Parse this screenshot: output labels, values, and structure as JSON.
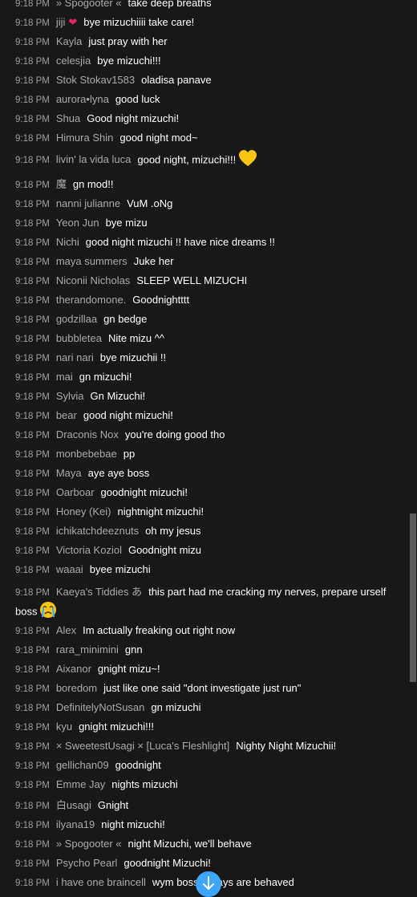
{
  "chat": {
    "messages": [
      {
        "time": "9:18 PM",
        "author": "» Spogooter «",
        "text": "take deep breaths"
      },
      {
        "time": "9:18 PM",
        "author": "jiji",
        "badge": "heart-icon",
        "text": "bye mizuchiiii take care!"
      },
      {
        "time": "9:18 PM",
        "author": "Kayla",
        "text": "just pray with her"
      },
      {
        "time": "9:18 PM",
        "author": "celesjia",
        "text": "bye mizuchi!!!"
      },
      {
        "time": "9:18 PM",
        "author": "Stok Stokav1583",
        "text": "oladisa panave"
      },
      {
        "time": "9:18 PM",
        "author": "aurora•lyna",
        "text": "good luck"
      },
      {
        "time": "9:18 PM",
        "author": "Shua",
        "text": "Good night mizuchi!"
      },
      {
        "time": "9:18 PM",
        "author": "Himura Shin",
        "text": "good night mod~"
      },
      {
        "time": "9:18 PM",
        "author": "livin' la vida luca",
        "text": "good night, mizuchi!!!",
        "emoji": "yellow-heart-emoji"
      },
      {
        "time": "9:18 PM",
        "author": "魔",
        "text": "gn mod!!"
      },
      {
        "time": "9:18 PM",
        "author": "nanni julianne",
        "text": "VuM .oNg"
      },
      {
        "time": "9:18 PM",
        "author": "Yeon Jun",
        "text": "bye mizu"
      },
      {
        "time": "9:18 PM",
        "author": "Nichi",
        "text": "good night mizuchi !! have nice dreams !!"
      },
      {
        "time": "9:18 PM",
        "author": "maya summers",
        "text": "Juke her"
      },
      {
        "time": "9:18 PM",
        "author": "Niconii Nicholas",
        "text": "SLEEP WELL MIZUCHI"
      },
      {
        "time": "9:18 PM",
        "author": "therandomone.",
        "text": "Goodnightttt"
      },
      {
        "time": "9:18 PM",
        "author": "godzillaa",
        "text": "gn bedge"
      },
      {
        "time": "9:18 PM",
        "author": "bubbletea",
        "text": "Nite mizu ^^"
      },
      {
        "time": "9:18 PM",
        "author": "nari nari",
        "text": "bye mizuchii !!"
      },
      {
        "time": "9:18 PM",
        "author": "mai",
        "text": "gn mizuchi!"
      },
      {
        "time": "9:18 PM",
        "author": "Sylvia",
        "text": "Gn Mizuchi!"
      },
      {
        "time": "9:18 PM",
        "author": "bear",
        "text": "good night mizuchi!"
      },
      {
        "time": "9:18 PM",
        "author": "Draconis Nox",
        "text": "you're doing good tho"
      },
      {
        "time": "9:18 PM",
        "author": "monbebebae",
        "text": "pp"
      },
      {
        "time": "9:18 PM",
        "author": "Maya",
        "text": "aye aye boss"
      },
      {
        "time": "9:18 PM",
        "author": "Oarboar",
        "text": "goodnight mizuchi!"
      },
      {
        "time": "9:18 PM",
        "author": "Honey (Kei)",
        "text": "nightnight mizuchi!"
      },
      {
        "time": "9:18 PM",
        "author": "ichikatchdeeznuts",
        "text": "oh my jesus"
      },
      {
        "time": "9:18 PM",
        "author": "Victoria Koziol",
        "text": "Goodnight mizu"
      },
      {
        "time": "9:18 PM",
        "author": "waaai",
        "text": "byee mizuchi"
      },
      {
        "time": "9:18 PM",
        "author": "Kaeya's Tiddies あ",
        "text": "this part had me cracking my nerves, prepare urself boss",
        "emoji": "crying-face-emoji"
      },
      {
        "time": "9:18 PM",
        "author": "Alex",
        "text": "Im actually freaking out right now"
      },
      {
        "time": "9:18 PM",
        "author": "rara_minimini",
        "text": "gnn"
      },
      {
        "time": "9:18 PM",
        "author": "Aixanor",
        "text": "gnight mizu~!"
      },
      {
        "time": "9:18 PM",
        "author": "boredom",
        "text": "just like one said \"dont investigate just run\""
      },
      {
        "time": "9:18 PM",
        "author": "DefinitelyNotSusan",
        "text": "gn mizuchi"
      },
      {
        "time": "9:18 PM",
        "author": "kyu",
        "text": "gnight mizuchi!!!"
      },
      {
        "time": "9:18 PM",
        "author": "× SweetestUsagi × [Luca's Fleshlight]",
        "text": "Nighty Night Mizuchii!"
      },
      {
        "time": "9:18 PM",
        "author": "gellichan09",
        "text": "goodnight"
      },
      {
        "time": "9:18 PM",
        "author": "Emme Jay",
        "text": "nights mizuchi"
      },
      {
        "time": "9:18 PM",
        "author": "白usagi",
        "text": "Gnight"
      },
      {
        "time": "9:18 PM",
        "author": "ilyana19",
        "text": "night mizuchi!"
      },
      {
        "time": "9:18 PM",
        "author": "» Spogooter «",
        "text": "night Mizuchi, we'll behave"
      },
      {
        "time": "9:18 PM",
        "author": "Psycho Pearl",
        "text": "goodnight Mizuchi!"
      },
      {
        "time": "9:18 PM",
        "author": "i have one braincell",
        "text": "wym boss always are behaved"
      }
    ]
  },
  "scroll_down_icon": "arrow-down-icon",
  "colors": {
    "background": "#181818",
    "author": "#a9a9a9",
    "timestamp": "#9e9e9e",
    "text": "#ffffff",
    "accent": "#3ea6ff"
  }
}
